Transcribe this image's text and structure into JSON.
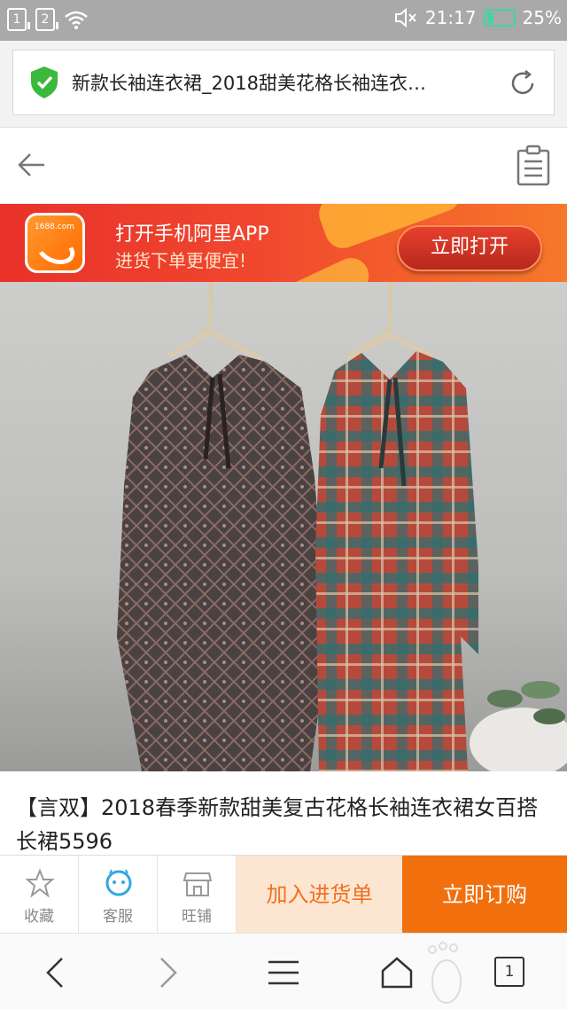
{
  "status": {
    "sim1": "1",
    "sim2": "2",
    "time": "21:17",
    "battery": "25%",
    "battery_level": 0.25,
    "accent": "#3fd6a8"
  },
  "browser": {
    "url_title": "新款长袖连衣裙_2018甜美花格长袖连衣…",
    "icons": [
      "shield-check-icon",
      "reload-icon"
    ]
  },
  "page_nav": {
    "icons": [
      "back-arrow-icon",
      "clipboard-icon"
    ]
  },
  "banner": {
    "logo_text": "1688.com",
    "title": "打开手机阿里APP",
    "subtitle": "进货下单更便宜!",
    "button_label": "立即打开"
  },
  "product": {
    "title": "【言双】2018春季新款甜美复古花格长袖连衣裙女百搭长裙5596"
  },
  "actions": {
    "favorite_label": "收藏",
    "service_label": "客服",
    "shop_label": "旺铺",
    "cart_label": "加入进货单",
    "buy_label": "立即订购",
    "accent": "#f1700d"
  },
  "browser_nav": {
    "tab_count": "1",
    "icons": [
      "back-icon",
      "forward-icon",
      "menu-icon",
      "home-icon",
      "tabs-icon"
    ]
  }
}
